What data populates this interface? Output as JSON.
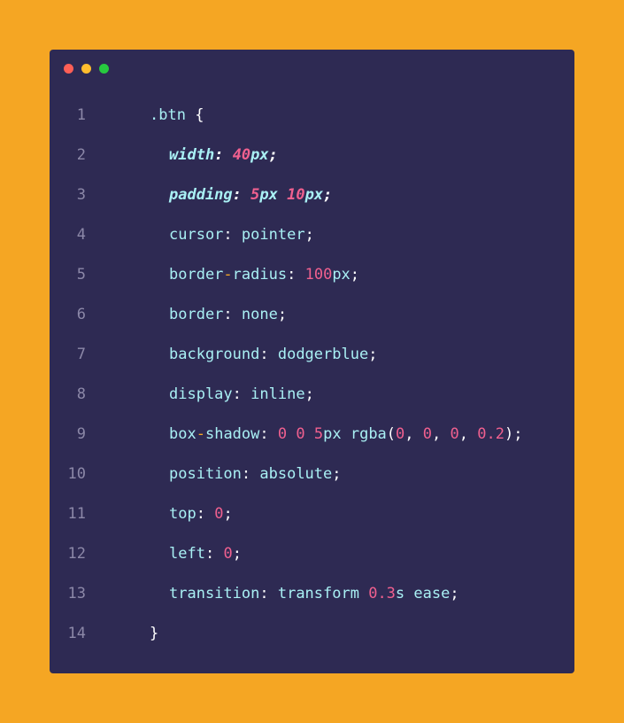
{
  "window": {
    "dots": [
      {
        "name": "close",
        "color": "#FF5F56"
      },
      {
        "name": "minimize",
        "color": "#FFBD2E"
      },
      {
        "name": "maximize",
        "color": "#27C93F"
      }
    ]
  },
  "colors": {
    "background": "#F5A623",
    "window": "#2E2A53",
    "property": "#A9F0F4",
    "number": "#F0608F",
    "punctuation": "#FFFFFF",
    "line_number": "#8C88A8"
  },
  "lines": [
    {
      "number": "1",
      "indent": 0,
      "italic": false,
      "tokens": [
        {
          "t": ".btn",
          "c": "default"
        },
        {
          "t": " {",
          "c": "punct"
        }
      ]
    },
    {
      "number": "2",
      "indent": 1,
      "italic": true,
      "tokens": [
        {
          "t": "width",
          "c": "default"
        },
        {
          "t": ":",
          "c": "punct"
        },
        {
          "t": " ",
          "c": "default"
        },
        {
          "t": "40",
          "c": "num"
        },
        {
          "t": "px",
          "c": "default"
        },
        {
          "t": ";",
          "c": "punct"
        }
      ]
    },
    {
      "number": "3",
      "indent": 1,
      "italic": true,
      "tokens": [
        {
          "t": "padding",
          "c": "default"
        },
        {
          "t": ":",
          "c": "punct"
        },
        {
          "t": " ",
          "c": "default"
        },
        {
          "t": "5",
          "c": "num"
        },
        {
          "t": "px ",
          "c": "default"
        },
        {
          "t": "10",
          "c": "num"
        },
        {
          "t": "px",
          "c": "default"
        },
        {
          "t": ";",
          "c": "punct"
        }
      ]
    },
    {
      "number": "4",
      "indent": 1,
      "italic": false,
      "tokens": [
        {
          "t": "cursor",
          "c": "default"
        },
        {
          "t": ":",
          "c": "punct"
        },
        {
          "t": " pointer",
          "c": "default"
        },
        {
          "t": ";",
          "c": "punct"
        }
      ]
    },
    {
      "number": "5",
      "indent": 1,
      "italic": false,
      "tokens": [
        {
          "t": "border",
          "c": "default"
        },
        {
          "t": "-",
          "c": "dash"
        },
        {
          "t": "radius",
          "c": "default"
        },
        {
          "t": ":",
          "c": "punct"
        },
        {
          "t": " ",
          "c": "default"
        },
        {
          "t": "100",
          "c": "num"
        },
        {
          "t": "px",
          "c": "default"
        },
        {
          "t": ";",
          "c": "punct"
        }
      ]
    },
    {
      "number": "6",
      "indent": 1,
      "italic": false,
      "tokens": [
        {
          "t": "border",
          "c": "default"
        },
        {
          "t": ":",
          "c": "punct"
        },
        {
          "t": " none",
          "c": "default"
        },
        {
          "t": ";",
          "c": "punct"
        }
      ]
    },
    {
      "number": "7",
      "indent": 1,
      "italic": false,
      "tokens": [
        {
          "t": "background",
          "c": "default"
        },
        {
          "t": ":",
          "c": "punct"
        },
        {
          "t": " dodgerblue",
          "c": "default"
        },
        {
          "t": ";",
          "c": "punct"
        }
      ]
    },
    {
      "number": "8",
      "indent": 1,
      "italic": false,
      "tokens": [
        {
          "t": "display",
          "c": "default"
        },
        {
          "t": ":",
          "c": "punct"
        },
        {
          "t": " inline",
          "c": "default"
        },
        {
          "t": ";",
          "c": "punct"
        }
      ]
    },
    {
      "number": "9",
      "indent": 1,
      "italic": false,
      "tokens": [
        {
          "t": "box",
          "c": "default"
        },
        {
          "t": "-",
          "c": "dash"
        },
        {
          "t": "shadow",
          "c": "default"
        },
        {
          "t": ":",
          "c": "punct"
        },
        {
          "t": " ",
          "c": "default"
        },
        {
          "t": "0",
          "c": "num"
        },
        {
          "t": " ",
          "c": "default"
        },
        {
          "t": "0",
          "c": "num"
        },
        {
          "t": " ",
          "c": "default"
        },
        {
          "t": "5",
          "c": "num"
        },
        {
          "t": "px rgba",
          "c": "default"
        },
        {
          "t": "(",
          "c": "punct"
        },
        {
          "t": "0",
          "c": "num"
        },
        {
          "t": ", ",
          "c": "punct"
        },
        {
          "t": "0",
          "c": "num"
        },
        {
          "t": ", ",
          "c": "punct"
        },
        {
          "t": "0",
          "c": "num"
        },
        {
          "t": ", ",
          "c": "punct"
        },
        {
          "t": "0.2",
          "c": "num"
        },
        {
          "t": ");",
          "c": "punct"
        }
      ]
    },
    {
      "number": "10",
      "indent": 1,
      "italic": false,
      "tokens": [
        {
          "t": "position",
          "c": "default"
        },
        {
          "t": ":",
          "c": "punct"
        },
        {
          "t": " absolute",
          "c": "default"
        },
        {
          "t": ";",
          "c": "punct"
        }
      ]
    },
    {
      "number": "11",
      "indent": 1,
      "italic": false,
      "tokens": [
        {
          "t": "top",
          "c": "default"
        },
        {
          "t": ":",
          "c": "punct"
        },
        {
          "t": " ",
          "c": "default"
        },
        {
          "t": "0",
          "c": "num"
        },
        {
          "t": ";",
          "c": "punct"
        }
      ]
    },
    {
      "number": "12",
      "indent": 1,
      "italic": false,
      "tokens": [
        {
          "t": "left",
          "c": "default"
        },
        {
          "t": ":",
          "c": "punct"
        },
        {
          "t": " ",
          "c": "default"
        },
        {
          "t": "0",
          "c": "num"
        },
        {
          "t": ";",
          "c": "punct"
        }
      ]
    },
    {
      "number": "13",
      "indent": 1,
      "italic": false,
      "tokens": [
        {
          "t": "transition",
          "c": "default"
        },
        {
          "t": ":",
          "c": "punct"
        },
        {
          "t": " transform ",
          "c": "default"
        },
        {
          "t": "0.3",
          "c": "num"
        },
        {
          "t": "s ease",
          "c": "default"
        },
        {
          "t": ";",
          "c": "punct"
        }
      ]
    },
    {
      "number": "14",
      "indent": 0,
      "italic": false,
      "tokens": [
        {
          "t": "}",
          "c": "punct"
        }
      ]
    }
  ]
}
